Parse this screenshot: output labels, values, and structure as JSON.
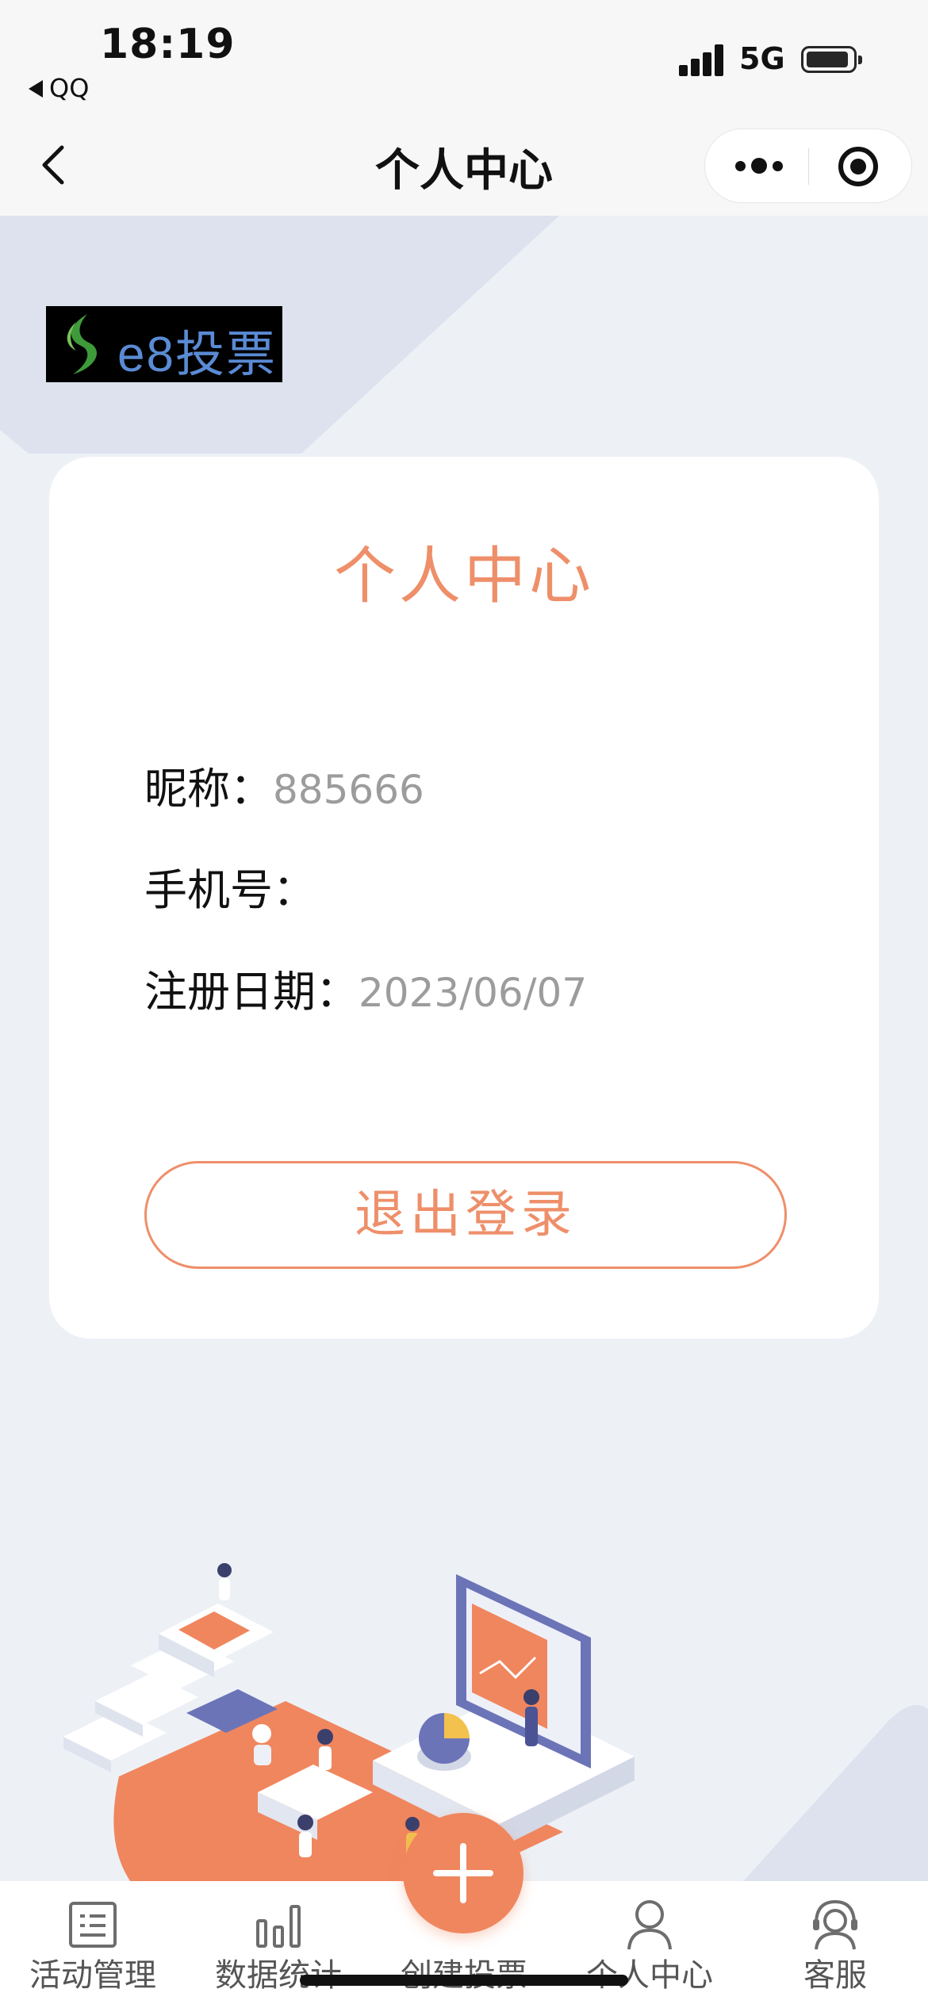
{
  "status_bar": {
    "time": "18:19",
    "back_app": "QQ",
    "network": "5G"
  },
  "nav": {
    "title": "个人中心"
  },
  "logo": {
    "text": "e8投票"
  },
  "profile": {
    "title": "个人中心",
    "nickname_label": "昵称：",
    "nickname_value": "885666",
    "phone_label": "手机号：",
    "phone_value": "",
    "register_label": "注册日期：",
    "register_value": "2023/06/07",
    "logout_label": "退出登录"
  },
  "tabs": [
    {
      "label": "活动管理",
      "icon": "list-icon"
    },
    {
      "label": "数据统计",
      "icon": "bar-chart-icon"
    },
    {
      "label": "创建投票",
      "icon": "plus-icon"
    },
    {
      "label": "个人中心",
      "icon": "user-icon"
    },
    {
      "label": "客服",
      "icon": "headset-icon"
    }
  ],
  "colors": {
    "accent": "#ee8f6a",
    "background": "#edf1f6",
    "card": "#ffffff"
  }
}
